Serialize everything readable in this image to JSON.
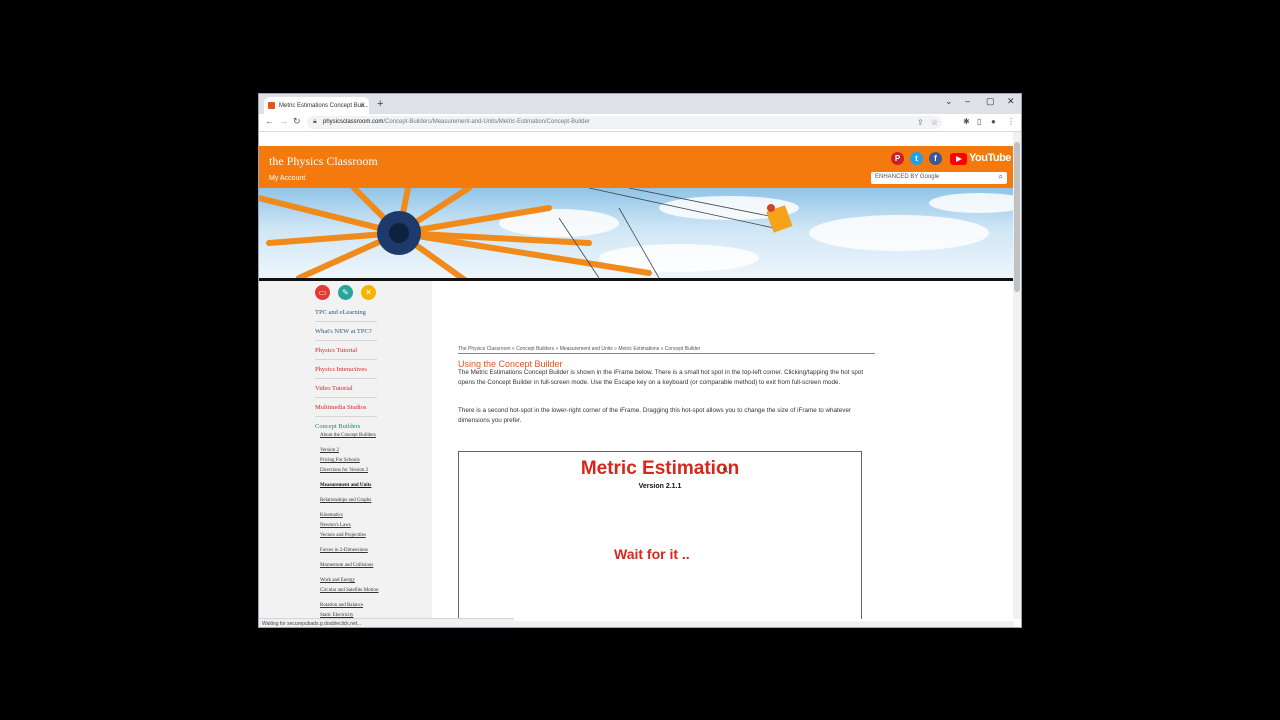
{
  "browser": {
    "tab_title": "Metric Estimations Concept Buil...",
    "tab_close": "×",
    "new_tab": "+",
    "url_host": "physicsclassroom.com",
    "url_path": "/Concept-Builders/Measurement-and-Units/Metric-Estimation/Concept-Builder",
    "status_text": "Waiting for securepubads.g.doubleclick.net..."
  },
  "site": {
    "title": "the Physics Classroom",
    "my_account": "My Account",
    "youtube_label": "YouTube",
    "search_placeholder": "ENHANCED BY Google",
    "header_color": "#f57a0d"
  },
  "sidebar": {
    "nav": [
      {
        "label": "TPC and eLearning",
        "color": "#1f5a8a"
      },
      {
        "label": "What's NEW at TPC?",
        "color": "#1f5a8a"
      },
      {
        "label": "Physics Tutorial",
        "color": "#d9261c"
      },
      {
        "label": "Physics Interactives",
        "color": "#d9261c"
      },
      {
        "label": "Video Tutorial",
        "color": "#d9261c"
      },
      {
        "label": "Multimedia Studios",
        "color": "#d9261c"
      },
      {
        "label": "Concept Builders",
        "color": "#1a8a6a"
      }
    ],
    "sub": [
      "About the Concept Builders",
      "Version 2",
      "Pricing For Schools",
      "Directions for Version 2",
      "Measurement and Units",
      "Relationships and Graphs",
      "Kinematics",
      "Newton's Laws",
      "Vectors and Projectiles",
      "Forces in 2-Dimensions",
      "Momentum and Collisions",
      "Work and Energy",
      "Circular and Satellite Motion",
      "Rotation and Balance",
      "Static Electricity"
    ]
  },
  "main": {
    "breadcrumb": "The Physics Classroom » Concept Builders » Measurement and Units » Metric Estimations » Concept Builder",
    "section_title": "Using the Concept Builder",
    "para1": "The Metric Estimations Concept Builder is shown in the iFrame below. There is a small hot spot in the top-left corner. Clicking/tapping the hot spot opens the Concept Builder in full-screen mode. Use the Escape key on a keyboard (or comparable method) to exit from full-screen mode.",
    "para2": "There is a second hot-spot in the lower-right corner of the iFrame. Dragging this hot-spot allows you to change the size of iFrame to whatever dimensions you prefer.",
    "frame_title": "Metric Estimation",
    "frame_version": "Version 2.1.1",
    "frame_wait": "Wait for it .."
  }
}
